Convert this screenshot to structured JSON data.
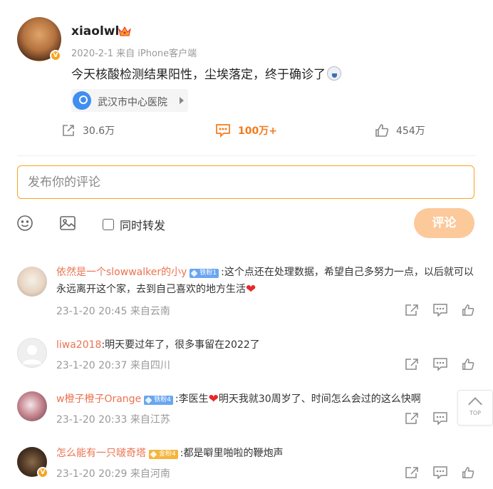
{
  "post": {
    "username": "xiaolwl",
    "verified_mark": "V",
    "crown_icon": "crown-icon",
    "date": "2020-2-1",
    "source": "来自 iPhone客户端",
    "text": "今天核酸检测结果阳性，尘埃落定，终于确诊了",
    "location": "武汉市中心医院",
    "shares": "30.6万",
    "comments": "100万+",
    "likes": "454万"
  },
  "composer": {
    "placeholder": "发布你的评论",
    "repost_label": "同时转发",
    "submit_label": "评论"
  },
  "comments": [
    {
      "name": "依然是一个slowwalker的小y",
      "badge": "铁粉1",
      "text": ":这个点还在处理数据，希望自己多努力一点，以后就可以永远离开这个家，去到自己喜欢的地方生活",
      "time": "23-1-20 20:45",
      "source": "来自云南"
    },
    {
      "name": "liwa2018",
      "text": ":明天要过年了，很多事留在2022了",
      "time": "23-1-20 20:37",
      "source": "来自四川"
    },
    {
      "name": "w橙子橙子Orange",
      "badge": "铁粉4",
      "text_a": ":李医生",
      "text_b": "明天我就30周岁了、时间怎么会过的这么快啊",
      "time": "23-1-20 20:33",
      "source": "来自江苏"
    },
    {
      "name": "怎么能有一只啵奇塔",
      "badge": "金粉4",
      "text": ":都是噼里啪啦的鞭炮声",
      "time": "23-1-20 20:29",
      "source": "来自河南"
    }
  ],
  "back_to_top": "TOP",
  "colors": {
    "accent": "#f37b1d",
    "name": "#eb7350",
    "submit_bg": "#fcc99b",
    "input_border": "#f5a623"
  }
}
